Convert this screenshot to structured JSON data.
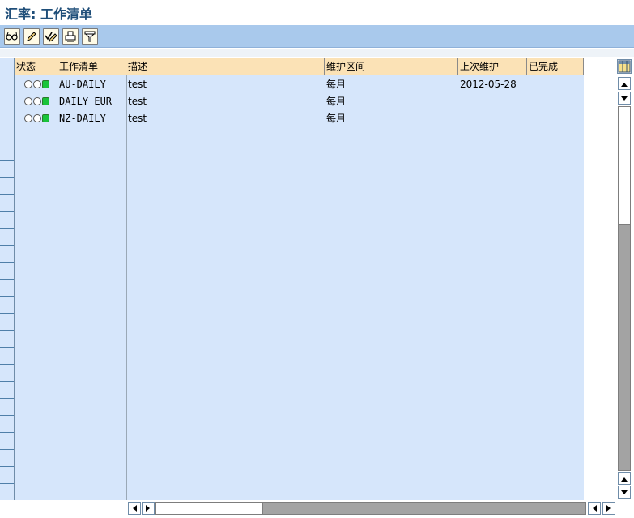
{
  "window": {
    "title": "汇率: 工作清单"
  },
  "toolbar": {
    "buttons": [
      {
        "icon": "glasses-display-icon"
      },
      {
        "icon": "pencil-edit-icon"
      },
      {
        "icon": "check-pencil-icon"
      },
      {
        "icon": "printer-icon"
      },
      {
        "icon": "filter-icon"
      }
    ]
  },
  "table": {
    "columns": {
      "status": "状态",
      "worklist": "工作清单",
      "description": "描述",
      "interval": "维护区间",
      "last_maintained": "上次维护",
      "completed": "已完成"
    },
    "rows": [
      {
        "worklist": "AU-DAILY",
        "description": "test",
        "interval": "每月",
        "last_maintained": "2012-05-28",
        "completed": ""
      },
      {
        "worklist": "DAILY EUR",
        "description": "test",
        "interval": "每月",
        "last_maintained": "",
        "completed": ""
      },
      {
        "worklist": "NZ-DAILY",
        "description": "test",
        "interval": "每月",
        "last_maintained": "",
        "completed": ""
      }
    ],
    "status_light_color": "#19c43a"
  },
  "colors": {
    "header_bg": "#fbe2b6",
    "grid_bg": "#d6e6fb",
    "toolbar_bg": "#a9c9ec",
    "title_color": "#1f4e79"
  }
}
